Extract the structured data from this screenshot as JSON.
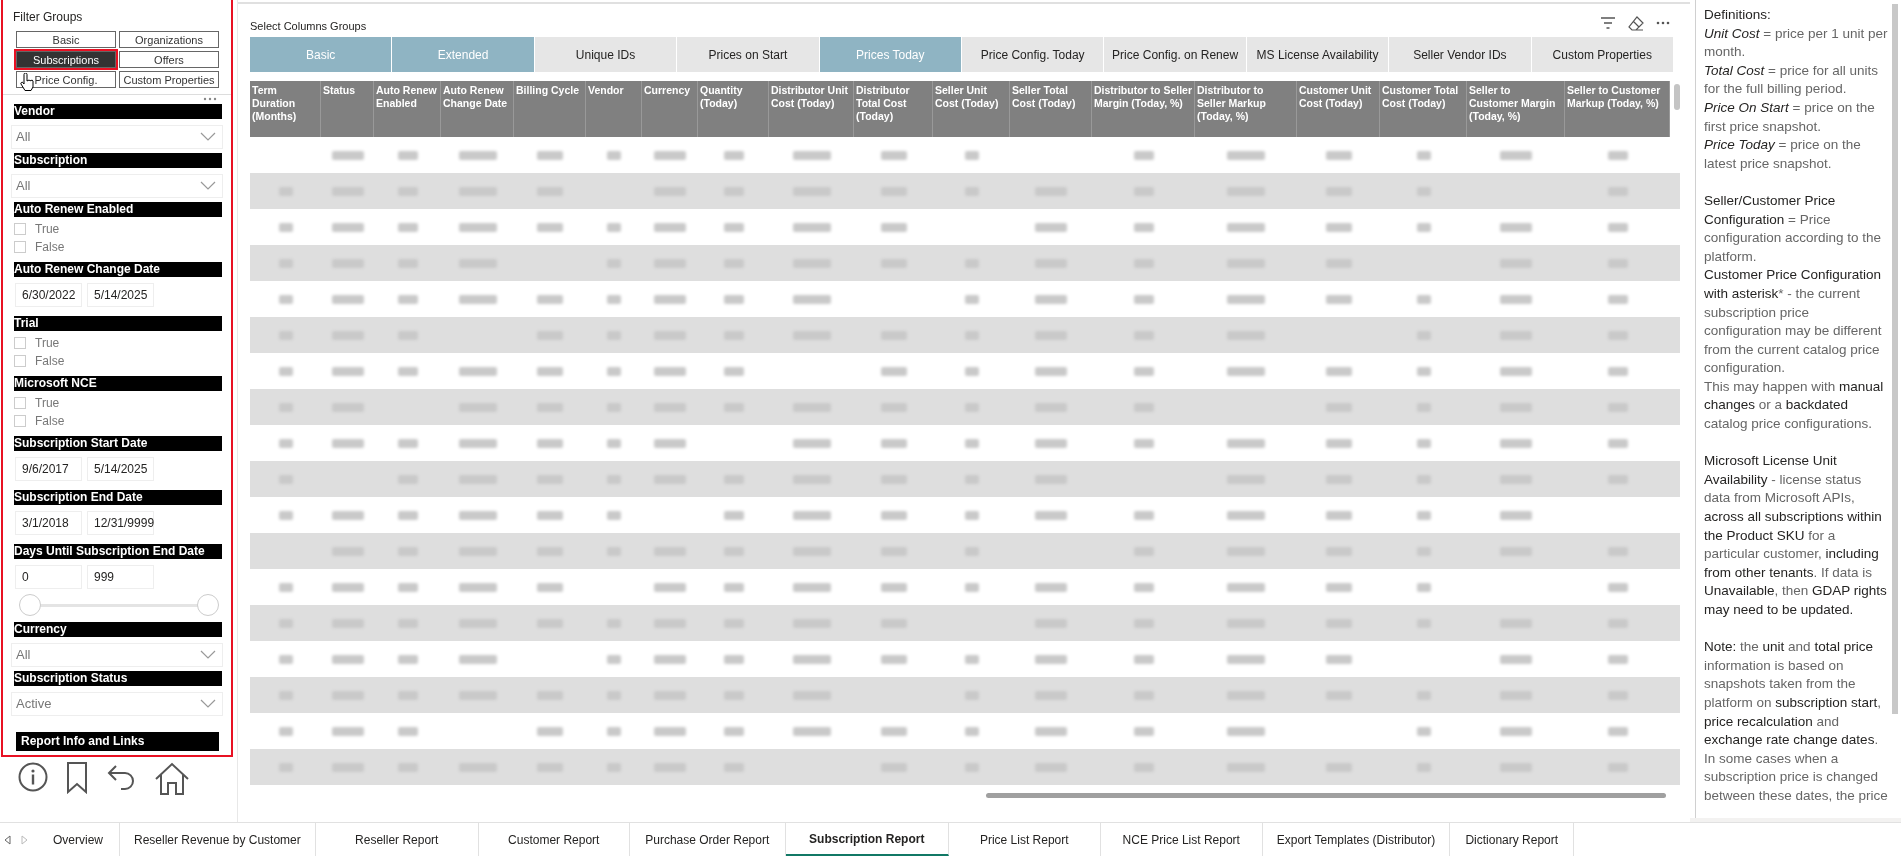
{
  "filter_groups": {
    "title": "Filter Groups",
    "buttons": [
      {
        "label": "Basic",
        "selected": false
      },
      {
        "label": "Organizations",
        "selected": false
      },
      {
        "label": "Subscriptions",
        "selected": true
      },
      {
        "label": "Offers",
        "selected": false
      },
      {
        "label": "Price Config.",
        "selected": false
      },
      {
        "label": "Custom Properties",
        "selected": false
      }
    ]
  },
  "filters": [
    {
      "kind": "dropdown",
      "label": "Vendor",
      "value": "All"
    },
    {
      "kind": "dropdown",
      "label": "Subscription",
      "value": "All"
    },
    {
      "kind": "checklist",
      "label": "Auto Renew Enabled",
      "options": [
        {
          "label": "True",
          "checked": false
        },
        {
          "label": "False",
          "checked": false
        }
      ]
    },
    {
      "kind": "daterange",
      "label": "Auto Renew Change Date",
      "from": "6/30/2022",
      "to": "5/14/2025"
    },
    {
      "kind": "checklist",
      "label": "Trial",
      "options": [
        {
          "label": "True",
          "checked": false
        },
        {
          "label": "False",
          "checked": false
        }
      ]
    },
    {
      "kind": "checklist",
      "label": "Microsoft NCE",
      "options": [
        {
          "label": "True",
          "checked": false
        },
        {
          "label": "False",
          "checked": false
        }
      ]
    },
    {
      "kind": "daterange",
      "label": "Subscription Start Date",
      "from": "9/6/2017",
      "to": "5/14/2025"
    },
    {
      "kind": "daterange",
      "label": "Subscription End Date",
      "from": "3/1/2018",
      "to": "12/31/9999"
    },
    {
      "kind": "range",
      "label": "Days Until Subscription End Date",
      "from": "0",
      "to": "999",
      "level": 1
    },
    {
      "kind": "dropdown",
      "label": "Currency",
      "value": "All"
    },
    {
      "kind": "dropdown",
      "label": "Subscription Status",
      "value": "Active"
    }
  ],
  "report_info_button": "Report Info and Links",
  "column_groups": {
    "title": "Select Columns Groups",
    "buttons": [
      {
        "label": "Basic",
        "selected": true
      },
      {
        "label": "Extended",
        "selected": true
      },
      {
        "label": "Unique IDs",
        "selected": false
      },
      {
        "label": "Prices on Start",
        "selected": false
      },
      {
        "label": "Prices Today",
        "selected": true
      },
      {
        "label": "Price Config. Today",
        "selected": false
      },
      {
        "label": "Price Config. on Renew",
        "selected": false
      },
      {
        "label": "MS License Availability",
        "selected": false
      },
      {
        "label": "Seller Vendor IDs",
        "selected": false
      },
      {
        "label": "Custom Properties",
        "selected": false
      }
    ]
  },
  "table": {
    "columns": [
      "Term Duration (Months)",
      "Status",
      "Auto Renew Enabled",
      "Auto Renew Change Date",
      "Billing Cycle",
      "Vendor",
      "Currency",
      "Quantity (Today)",
      "Distributor Unit Cost (Today)",
      "Distributor Total Cost (Today)",
      "Seller Unit Cost (Today)",
      "Seller Total Cost (Today)",
      "Distributor to Seller Margin (Today, %)",
      "Distributor to Seller Markup (Today, %)",
      "Customer Unit Cost (Today)",
      "Customer Total Cost (Today)",
      "Seller to Customer Margin (Today, %)",
      "Seller to Customer Markup (Today, %)"
    ],
    "rows": [
      {
        "shaded": false
      },
      {
        "shaded": true
      },
      {
        "shaded": false
      },
      {
        "shaded": true
      },
      {
        "shaded": false
      },
      {
        "shaded": true
      },
      {
        "shaded": false
      },
      {
        "shaded": true
      },
      {
        "shaded": false
      },
      {
        "shaded": true
      },
      {
        "shaded": false
      },
      {
        "shaded": true
      },
      {
        "shaded": false
      },
      {
        "shaded": true
      },
      {
        "shaded": false
      },
      {
        "shaded": true
      },
      {
        "shaded": false
      },
      {
        "shaded": true
      }
    ]
  },
  "definitions": [
    [
      "**Definitions:**",
      "*Unit Cost* = price per 1 unit per month.",
      "*Total Cost* = price for all units for the full billing period.",
      "*Price On Start* = price on the first price snapshot.",
      "*Price Today* = price on the latest price snapshot."
    ],
    [
      "**Seller/Customer Price Configuration** = Price configuration according to the platform.",
      "**Customer Price Configuration with asterisk*** - the current subscription price configuration may be different from the current catalog price configuration.",
      "This may happen with **manual changes** or a **backdated** catalog price configurations."
    ],
    [
      "**Microsoft License Unit Availability** - license status data from Microsoft APIs, **across all subscriptions within the Product SKU** for a particular customer, **including from other tenants**. If data is **Unavailable**, then **GDAP rights may need to be updated.**"
    ],
    [
      "**Note:** the **unit** and **total price** information is based on snapshots taken from the platform on **subscription start**, **price recalculation** and **exchange rate change dates**. In some cases when a subscription price is changed between these dates, the price"
    ]
  ],
  "page_tabs": [
    {
      "label": "Overview",
      "selected": false
    },
    {
      "label": "Reseller Revenue by Customer",
      "selected": false
    },
    {
      "label": "Reseller Report",
      "selected": false
    },
    {
      "label": "Customer Report",
      "selected": false
    },
    {
      "label": "Purchase Order Report",
      "selected": false
    },
    {
      "label": "Subscription Report",
      "selected": true
    },
    {
      "label": "Price List Report",
      "selected": false
    },
    {
      "label": "NCE Price List Report",
      "selected": false
    },
    {
      "label": "Export Templates (Distributor)",
      "selected": false
    },
    {
      "label": "Dictionary Report",
      "selected": false
    }
  ]
}
